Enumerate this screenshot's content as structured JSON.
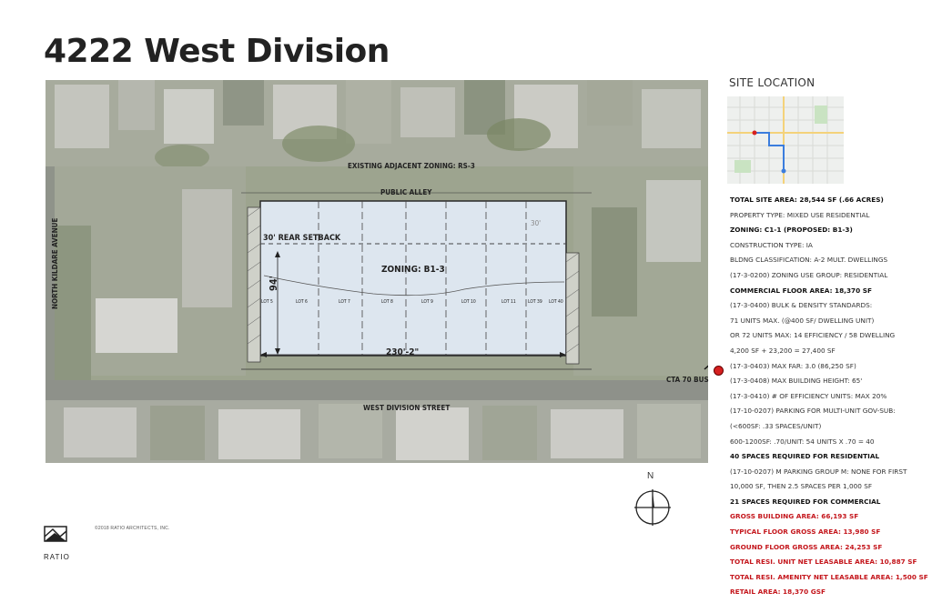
{
  "title": "4222 West Division",
  "site_location": {
    "heading": "SITE LOCATION"
  },
  "map": {
    "labels": {
      "adjacent_zoning": "EXISTING ADJACENT ZONING: RS-3",
      "public_alley": "PUBLIC ALLEY",
      "rear_setback": "30' REAR SETBACK",
      "zoning": "ZONING: B1-3",
      "width_dim": "230'-2\"",
      "depth_dim": "94'",
      "west_division": "WEST DIVISION STREET",
      "north_kildare": "NORTH KILDARE AVENUE",
      "cta_bus": "CTA 70 BUS",
      "setback_small": "30'"
    },
    "lots": [
      "LOT 5",
      "LOT 6",
      "LOT 7",
      "LOT 8",
      "LOT 9",
      "LOT 10",
      "LOT 11",
      "LOT 39",
      "LOT 40"
    ],
    "colors": {
      "site_fill": "#dde6ef",
      "bus_dot": "#d62020"
    }
  },
  "notes": [
    {
      "text": "TOTAL SITE AREA: 28,544 SF (.66 ACRES)",
      "style": "b"
    },
    {
      "text": "PROPERTY TYPE: MIXED USE RESIDENTIAL",
      "style": ""
    },
    {
      "text": "ZONING: C1-1 (PROPOSED: B1-3)",
      "style": "b"
    },
    {
      "text": "CONSTRUCTION TYPE: IA",
      "style": ""
    },
    {
      "text": "BLDNG CLASSIFICATION: A-2 MULT. DWELLINGS",
      "style": ""
    },
    {
      "text": "(17-3-0200) ZONING USE GROUP: RESIDENTIAL",
      "style": ""
    },
    {
      "text": "COMMERCIAL FLOOR AREA: 18,370 SF",
      "style": "b"
    },
    {
      "text": "(17-3-0400) BULK & DENSITY STANDARDS:",
      "style": ""
    },
    {
      "text": "71 UNITS MAX. (@400 SF/ DWELLING UNIT)",
      "style": ""
    },
    {
      "text": "OR 72 UNITS MAX: 14 EFFICIENCY / 58 DWELLING",
      "style": ""
    },
    {
      "text": "4,200 SF + 23,200 = 27,400 SF",
      "style": ""
    },
    {
      "text": "(17-3-0403) MAX FAR: 3.0 (86,250 SF)",
      "style": ""
    },
    {
      "text": "(17-3-0408) MAX BUILDING HEIGHT: 65'",
      "style": ""
    },
    {
      "text": "(17-3-0410) # OF EFFICIENCY UNITS: MAX 20%",
      "style": ""
    },
    {
      "text": "(17-10-0207) PARKING FOR MULTI-UNIT GOV-SUB:",
      "style": ""
    },
    {
      "text": "(<600SF: .33 SPACES/UNIT)",
      "style": ""
    },
    {
      "text": "600-1200SF: .70/UNIT: 54 UNITS X .70 = 40",
      "style": ""
    },
    {
      "text": "40 SPACES REQUIRED FOR RESIDENTIAL",
      "style": "b"
    },
    {
      "text": "(17-10-0207) M PARKING GROUP M: NONE FOR FIRST",
      "style": ""
    },
    {
      "text": "10,000 SF, THEN 2.5 SPACES PER 1,000 SF",
      "style": ""
    },
    {
      "text": "21 SPACES REQUIRED FOR COMMERCIAL",
      "style": "b"
    },
    {
      "text": "GROSS BUILDING AREA: 66,193 SF",
      "style": "r"
    },
    {
      "text": "TYPICAL FLOOR GROSS AREA: 13,980 SF",
      "style": "r"
    },
    {
      "text": "GROUND FLOOR GROSS AREA: 24,253 SF",
      "style": "r"
    },
    {
      "text": "TOTAL RESI. UNIT NET LEASABLE AREA: 10,887 SF",
      "style": "r"
    },
    {
      "text": "TOTAL RESI. AMENITY NET LEASABLE AREA: 1,500 SF",
      "style": "r"
    },
    {
      "text": "RETAIL AREA: 18,370 GSF",
      "style": "r"
    }
  ],
  "compass": {
    "label": "N"
  },
  "footer": {
    "copyright": "©2018 RATIO ARCHITECTS, INC.",
    "brand": "RATIO"
  }
}
